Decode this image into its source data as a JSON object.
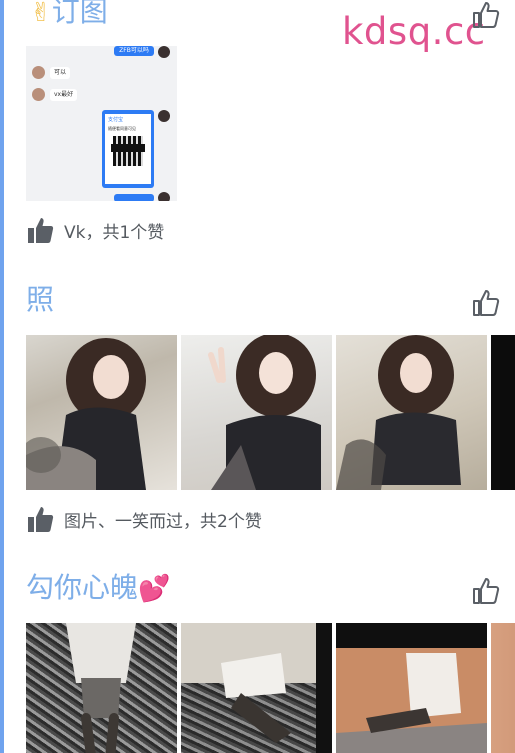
{
  "watermark": "kdsq.cc",
  "posts": [
    {
      "title": "订图",
      "title_emoji": "✌",
      "like_summary": "Vk，共1个赞",
      "chat": {
        "top_bubble": "ZFB可以吗",
        "msg1": "可以",
        "msg2": "vx最好",
        "card_header": "支付宝",
        "card_line": "随便看同意可见"
      }
    },
    {
      "title": "照",
      "like_summary": "图片、一笑而过，共2个赞"
    },
    {
      "title": "勾你心魄",
      "title_emoji": "💕"
    }
  ],
  "colors": {
    "title": "#7eaee8",
    "watermark": "#e0538f",
    "rail": "#6fa3ee",
    "icon": "#5a5f66"
  },
  "icons": {
    "like_button": "thumbs-up-outline-icon",
    "like_summary": "thumbs-up-filled-icon"
  }
}
